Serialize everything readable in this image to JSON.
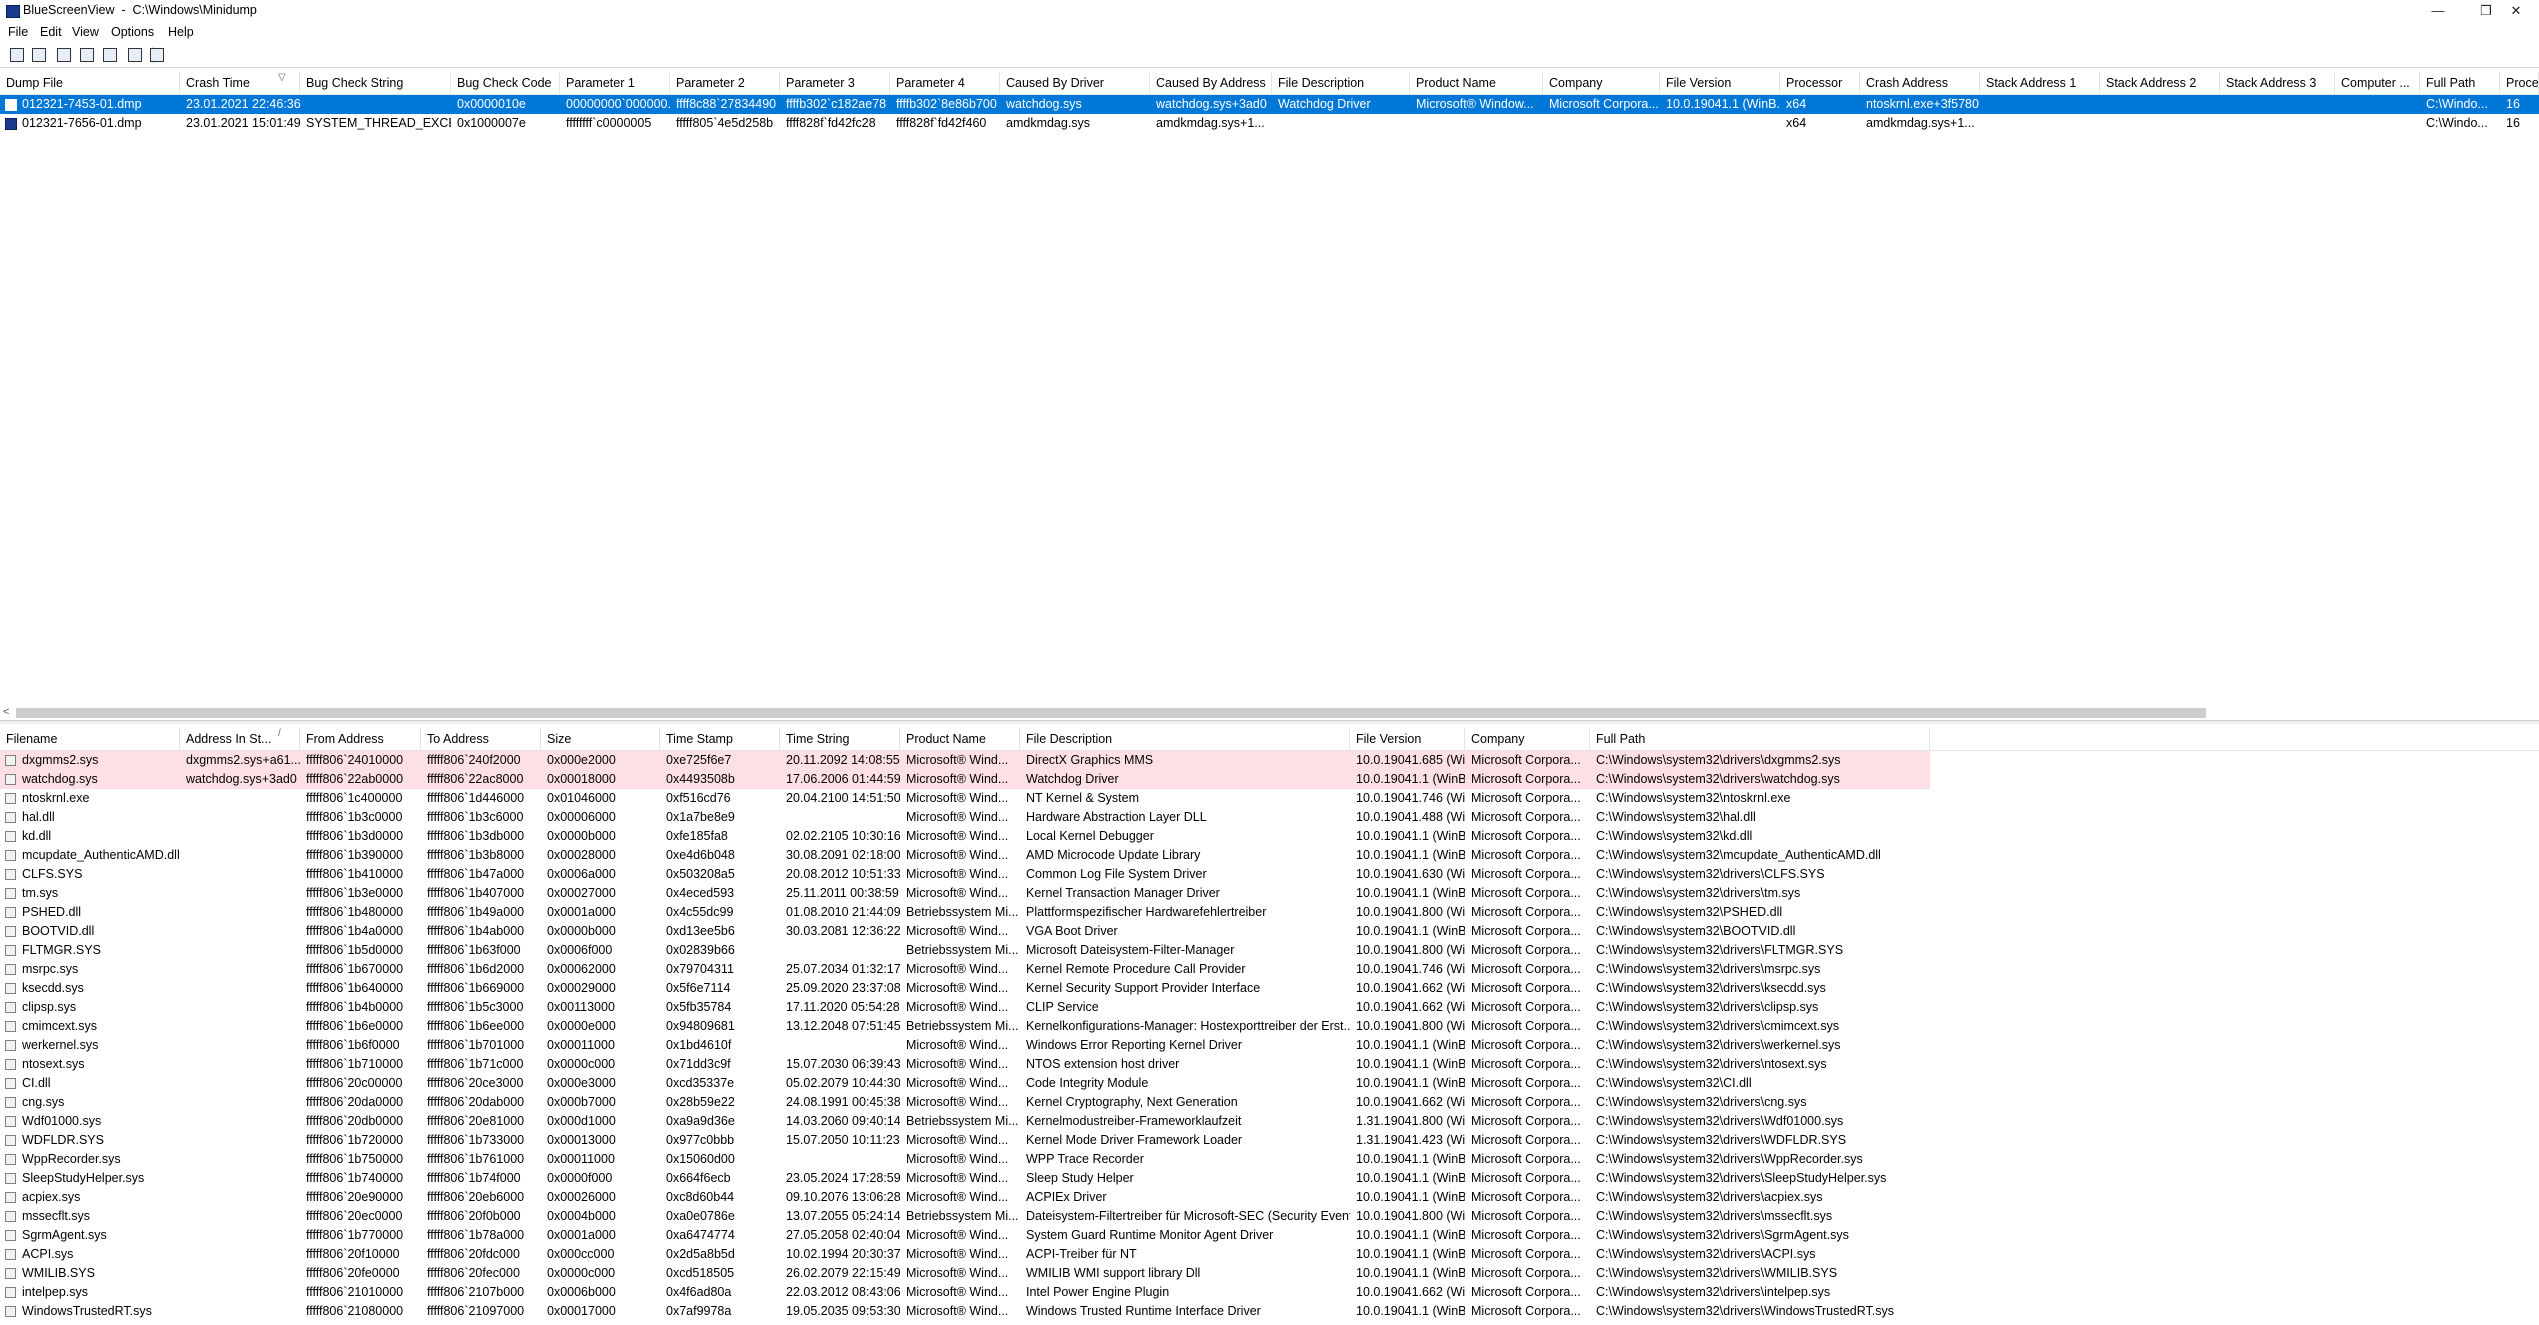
{
  "window": {
    "title": "BlueScreenView  -  C:\\Windows\\Minidump",
    "minimize_glyph": "—",
    "restore_glyph": "❐",
    "close_glyph": "✕"
  },
  "menu": [
    "File",
    "Edit",
    "View",
    "Options",
    "Help"
  ],
  "toolbar": {
    "icons": [
      "save-icon",
      "save-all-icon",
      "refresh-icon",
      "copy-icon",
      "properties-icon",
      "html-report-icon",
      "exit-icon"
    ]
  },
  "top_table": {
    "columns": [
      "Dump File",
      "Crash Time",
      "Bug Check String",
      "Bug Check Code",
      "Parameter 1",
      "Parameter 2",
      "Parameter 3",
      "Parameter 4",
      "Caused By Driver",
      "Caused By Address",
      "File Description",
      "Product Name",
      "Company",
      "File Version",
      "Processor",
      "Crash Address",
      "Stack Address 1",
      "Stack Address 2",
      "Stack Address 3",
      "Computer ...",
      "Full Path",
      "Proces"
    ],
    "sort_indicator": "▽",
    "rows": [
      {
        "selected": true,
        "cells": [
          "012321-7453-01.dmp",
          "23.01.2021 22:46:36",
          "",
          "0x0000010e",
          "00000000`000000...",
          "ffff8c88`27834490",
          "ffffb302`c182ae78",
          "ffffb302`8e86b700",
          "watchdog.sys",
          "watchdog.sys+3ad0",
          "Watchdog Driver",
          "Microsoft® Window...",
          "Microsoft Corpora...",
          "10.0.19041.1 (WinB...",
          "x64",
          "ntoskrnl.exe+3f5780",
          "",
          "",
          "",
          "",
          "C:\\Windo...",
          "16"
        ]
      },
      {
        "selected": false,
        "cells": [
          "012321-7656-01.dmp",
          "23.01.2021 15:01:49",
          "SYSTEM_THREAD_EXCE...",
          "0x1000007e",
          "ffffffff`c0000005",
          "fffff805`4e5d258b",
          "ffff828f`fd42fc28",
          "ffff828f`fd42f460",
          "amdkmdag.sys",
          "amdkmdag.sys+1...",
          "",
          "",
          "",
          "",
          "x64",
          "amdkmdag.sys+1...",
          "",
          "",
          "",
          "",
          "C:\\Windo...",
          "16"
        ]
      }
    ]
  },
  "bottom_table": {
    "columns": [
      "Filename",
      "Address In St...",
      "From Address",
      "To Address",
      "Size",
      "Time Stamp",
      "Time String",
      "Product Name",
      "File Description",
      "File Version",
      "Company",
      "Full Path"
    ],
    "sort_indicator": "/",
    "rows": [
      {
        "hl": true,
        "cells": [
          "dxgmms2.sys",
          "dxgmms2.sys+a61...",
          "fffff806`24010000",
          "fffff806`240f2000",
          "0x000e2000",
          "0xe725f6e7",
          "20.11.2092 14:08:55",
          "Microsoft® Wind...",
          "DirectX Graphics MMS",
          "10.0.19041.685 (Wi...",
          "Microsoft Corpora...",
          "C:\\Windows\\system32\\drivers\\dxgmms2.sys"
        ]
      },
      {
        "hl": true,
        "cells": [
          "watchdog.sys",
          "watchdog.sys+3ad0",
          "fffff806`22ab0000",
          "fffff806`22ac8000",
          "0x00018000",
          "0x4493508b",
          "17.06.2006 01:44:59",
          "Microsoft® Wind...",
          "Watchdog Driver",
          "10.0.19041.1 (WinB...",
          "Microsoft Corpora...",
          "C:\\Windows\\system32\\drivers\\watchdog.sys"
        ]
      },
      {
        "hl": false,
        "cells": [
          "ntoskrnl.exe",
          "",
          "fffff806`1c400000",
          "fffff806`1d446000",
          "0x01046000",
          "0xf516cd76",
          "20.04.2100 14:51:50",
          "Microsoft® Wind...",
          "NT Kernel & System",
          "10.0.19041.746 (Wi...",
          "Microsoft Corpora...",
          "C:\\Windows\\system32\\ntoskrnl.exe"
        ]
      },
      {
        "hl": false,
        "cells": [
          "hal.dll",
          "",
          "fffff806`1b3c0000",
          "fffff806`1b3c6000",
          "0x00006000",
          "0x1a7be8e9",
          "",
          "Microsoft® Wind...",
          "Hardware Abstraction Layer DLL",
          "10.0.19041.488 (Wi...",
          "Microsoft Corpora...",
          "C:\\Windows\\system32\\hal.dll"
        ]
      },
      {
        "hl": false,
        "cells": [
          "kd.dll",
          "",
          "fffff806`1b3d0000",
          "fffff806`1b3db000",
          "0x0000b000",
          "0xfe185fa8",
          "02.02.2105 10:30:16",
          "Microsoft® Wind...",
          "Local Kernel Debugger",
          "10.0.19041.1 (WinB...",
          "Microsoft Corpora...",
          "C:\\Windows\\system32\\kd.dll"
        ]
      },
      {
        "hl": false,
        "cells": [
          "mcupdate_AuthenticAMD.dll",
          "",
          "fffff806`1b390000",
          "fffff806`1b3b8000",
          "0x00028000",
          "0xe4d6b048",
          "30.08.2091 02:18:00",
          "Microsoft® Wind...",
          "AMD Microcode Update Library",
          "10.0.19041.1 (WinB...",
          "Microsoft Corpora...",
          "C:\\Windows\\system32\\mcupdate_AuthenticAMD.dll"
        ]
      },
      {
        "hl": false,
        "cells": [
          "CLFS.SYS",
          "",
          "fffff806`1b410000",
          "fffff806`1b47a000",
          "0x0006a000",
          "0x503208a5",
          "20.08.2012 10:51:33",
          "Microsoft® Wind...",
          "Common Log File System Driver",
          "10.0.19041.630 (Wi...",
          "Microsoft Corpora...",
          "C:\\Windows\\system32\\drivers\\CLFS.SYS"
        ]
      },
      {
        "hl": false,
        "cells": [
          "tm.sys",
          "",
          "fffff806`1b3e0000",
          "fffff806`1b407000",
          "0x00027000",
          "0x4eced593",
          "25.11.2011 00:38:59",
          "Microsoft® Wind...",
          "Kernel Transaction Manager Driver",
          "10.0.19041.1 (WinB...",
          "Microsoft Corpora...",
          "C:\\Windows\\system32\\drivers\\tm.sys"
        ]
      },
      {
        "hl": false,
        "cells": [
          "PSHED.dll",
          "",
          "fffff806`1b480000",
          "fffff806`1b49a000",
          "0x0001a000",
          "0x4c55dc99",
          "01.08.2010 21:44:09",
          "Betriebssystem Mi...",
          "Plattformspezifischer Hardwarefehlertreiber",
          "10.0.19041.800 (Wi...",
          "Microsoft Corpora...",
          "C:\\Windows\\system32\\PSHED.dll"
        ]
      },
      {
        "hl": false,
        "cells": [
          "BOOTVID.dll",
          "",
          "fffff806`1b4a0000",
          "fffff806`1b4ab000",
          "0x0000b000",
          "0xd13ee5b6",
          "30.03.2081 12:36:22",
          "Microsoft® Wind...",
          "VGA Boot Driver",
          "10.0.19041.1 (WinB...",
          "Microsoft Corpora...",
          "C:\\Windows\\system32\\BOOTVID.dll"
        ]
      },
      {
        "hl": false,
        "cells": [
          "FLTMGR.SYS",
          "",
          "fffff806`1b5d0000",
          "fffff806`1b63f000",
          "0x0006f000",
          "0x02839b66",
          "",
          "Betriebssystem Mi...",
          "Microsoft Dateisystem-Filter-Manager",
          "10.0.19041.800 (Wi...",
          "Microsoft Corpora...",
          "C:\\Windows\\system32\\drivers\\FLTMGR.SYS"
        ]
      },
      {
        "hl": false,
        "cells": [
          "msrpc.sys",
          "",
          "fffff806`1b670000",
          "fffff806`1b6d2000",
          "0x00062000",
          "0x79704311",
          "25.07.2034 01:32:17",
          "Microsoft® Wind...",
          "Kernel Remote Procedure Call Provider",
          "10.0.19041.746 (Wi...",
          "Microsoft Corpora...",
          "C:\\Windows\\system32\\drivers\\msrpc.sys"
        ]
      },
      {
        "hl": false,
        "cells": [
          "ksecdd.sys",
          "",
          "fffff806`1b640000",
          "fffff806`1b669000",
          "0x00029000",
          "0x5f6e7114",
          "25.09.2020 23:37:08",
          "Microsoft® Wind...",
          "Kernel Security Support Provider Interface",
          "10.0.19041.662 (Wi...",
          "Microsoft Corpora...",
          "C:\\Windows\\system32\\drivers\\ksecdd.sys"
        ]
      },
      {
        "hl": false,
        "cells": [
          "clipsp.sys",
          "",
          "fffff806`1b4b0000",
          "fffff806`1b5c3000",
          "0x00113000",
          "0x5fb35784",
          "17.11.2020 05:54:28",
          "Microsoft® Wind...",
          "CLIP Service",
          "10.0.19041.662 (Wi...",
          "Microsoft Corpora...",
          "C:\\Windows\\system32\\drivers\\clipsp.sys"
        ]
      },
      {
        "hl": false,
        "cells": [
          "cmimcext.sys",
          "",
          "fffff806`1b6e0000",
          "fffff806`1b6ee000",
          "0x0000e000",
          "0x94809681",
          "13.12.2048 07:51:45",
          "Betriebssystem Mi...",
          "Kernelkonfigurations-Manager: Hostexporttreiber der Erst...",
          "10.0.19041.800 (Wi...",
          "Microsoft Corpora...",
          "C:\\Windows\\system32\\drivers\\cmimcext.sys"
        ]
      },
      {
        "hl": false,
        "cells": [
          "werkernel.sys",
          "",
          "fffff806`1b6f0000",
          "fffff806`1b701000",
          "0x00011000",
          "0x1bd4610f",
          "",
          "Microsoft® Wind...",
          "Windows Error Reporting Kernel Driver",
          "10.0.19041.1 (WinB...",
          "Microsoft Corpora...",
          "C:\\Windows\\system32\\drivers\\werkernel.sys"
        ]
      },
      {
        "hl": false,
        "cells": [
          "ntosext.sys",
          "",
          "fffff806`1b710000",
          "fffff806`1b71c000",
          "0x0000c000",
          "0x71dd3c9f",
          "15.07.2030 06:39:43",
          "Microsoft® Wind...",
          "NTOS extension host driver",
          "10.0.19041.1 (WinB...",
          "Microsoft Corpora...",
          "C:\\Windows\\system32\\drivers\\ntosext.sys"
        ]
      },
      {
        "hl": false,
        "cells": [
          "CI.dll",
          "",
          "fffff806`20c00000",
          "fffff806`20ce3000",
          "0x000e3000",
          "0xcd35337e",
          "05.02.2079 10:44:30",
          "Microsoft® Wind...",
          "Code Integrity Module",
          "10.0.19041.1 (WinB...",
          "Microsoft Corpora...",
          "C:\\Windows\\system32\\CI.dll"
        ]
      },
      {
        "hl": false,
        "cells": [
          "cng.sys",
          "",
          "fffff806`20da0000",
          "fffff806`20dab000",
          "0x000b7000",
          "0x28b59e22",
          "24.08.1991 00:45:38",
          "Microsoft® Wind...",
          "Kernel Cryptography, Next Generation",
          "10.0.19041.662 (Wi...",
          "Microsoft Corpora...",
          "C:\\Windows\\system32\\drivers\\cng.sys"
        ]
      },
      {
        "hl": false,
        "cells": [
          "Wdf01000.sys",
          "",
          "fffff806`20db0000",
          "fffff806`20e81000",
          "0x000d1000",
          "0xa9a9d36e",
          "14.03.2060 09:40:14",
          "Betriebssystem Mi...",
          "Kernelmodustreiber-Frameworklaufzeit",
          "1.31.19041.800 (Wi...",
          "Microsoft Corpora...",
          "C:\\Windows\\system32\\drivers\\Wdf01000.sys"
        ]
      },
      {
        "hl": false,
        "cells": [
          "WDFLDR.SYS",
          "",
          "fffff806`1b720000",
          "fffff806`1b733000",
          "0x00013000",
          "0x977c0bbb",
          "15.07.2050 10:11:23",
          "Microsoft® Wind...",
          "Kernel Mode Driver Framework Loader",
          "1.31.19041.423 (Wi...",
          "Microsoft Corpora...",
          "C:\\Windows\\system32\\drivers\\WDFLDR.SYS"
        ]
      },
      {
        "hl": false,
        "cells": [
          "WppRecorder.sys",
          "",
          "fffff806`1b750000",
          "fffff806`1b761000",
          "0x00011000",
          "0x15060d00",
          "",
          "Microsoft® Wind...",
          "WPP Trace Recorder",
          "10.0.19041.1 (WinB...",
          "Microsoft Corpora...",
          "C:\\Windows\\system32\\drivers\\WppRecorder.sys"
        ]
      },
      {
        "hl": false,
        "cells": [
          "SleepStudyHelper.sys",
          "",
          "fffff806`1b740000",
          "fffff806`1b74f000",
          "0x0000f000",
          "0x664f6ecb",
          "23.05.2024 17:28:59",
          "Microsoft® Wind...",
          "Sleep Study Helper",
          "10.0.19041.1 (WinB...",
          "Microsoft Corpora...",
          "C:\\Windows\\system32\\drivers\\SleepStudyHelper.sys"
        ]
      },
      {
        "hl": false,
        "cells": [
          "acpiex.sys",
          "",
          "fffff806`20e90000",
          "fffff806`20eb6000",
          "0x00026000",
          "0xc8d60b44",
          "09.10.2076 13:06:28",
          "Microsoft® Wind...",
          "ACPIEx Driver",
          "10.0.19041.1 (WinB...",
          "Microsoft Corpora...",
          "C:\\Windows\\system32\\drivers\\acpiex.sys"
        ]
      },
      {
        "hl": false,
        "cells": [
          "mssecflt.sys",
          "",
          "fffff806`20ec0000",
          "fffff806`20f0b000",
          "0x0004b000",
          "0xa0e0786e",
          "13.07.2055 05:24:14",
          "Betriebssystem Mi...",
          "Dateisystem-Filtertreiber für Microsoft-SEC (Security Event...",
          "10.0.19041.800 (Wi...",
          "Microsoft Corpora...",
          "C:\\Windows\\system32\\drivers\\mssecflt.sys"
        ]
      },
      {
        "hl": false,
        "cells": [
          "SgrmAgent.sys",
          "",
          "fffff806`1b770000",
          "fffff806`1b78a000",
          "0x0001a000",
          "0xa6474774",
          "27.05.2058 02:40:04",
          "Microsoft® Wind...",
          "System Guard Runtime Monitor Agent Driver",
          "10.0.19041.1 (WinB...",
          "Microsoft Corpora...",
          "C:\\Windows\\system32\\drivers\\SgrmAgent.sys"
        ]
      },
      {
        "hl": false,
        "cells": [
          "ACPI.sys",
          "",
          "fffff806`20f10000",
          "fffff806`20fdc000",
          "0x000cc000",
          "0x2d5a8b5d",
          "10.02.1994 20:30:37",
          "Microsoft® Wind...",
          "ACPI-Treiber für NT",
          "10.0.19041.1 (WinB...",
          "Microsoft Corpora...",
          "C:\\Windows\\system32\\drivers\\ACPI.sys"
        ]
      },
      {
        "hl": false,
        "cells": [
          "WMILIB.SYS",
          "",
          "fffff806`20fe0000",
          "fffff806`20fec000",
          "0x0000c000",
          "0xcd518505",
          "26.02.2079 22:15:49",
          "Microsoft® Wind...",
          "WMILIB WMI support library Dll",
          "10.0.19041.1 (WinB...",
          "Microsoft Corpora...",
          "C:\\Windows\\system32\\drivers\\WMILIB.SYS"
        ]
      },
      {
        "hl": false,
        "cells": [
          "intelpep.sys",
          "",
          "fffff806`21010000",
          "fffff806`2107b000",
          "0x0006b000",
          "0x4f6ad80a",
          "22.03.2012 08:43:06",
          "Microsoft® Wind...",
          "Intel Power Engine Plugin",
          "10.0.19041.662 (Wi...",
          "Microsoft Corpora...",
          "C:\\Windows\\system32\\drivers\\intelpep.sys"
        ]
      },
      {
        "hl": false,
        "cells": [
          "WindowsTrustedRT.sys",
          "",
          "fffff806`21080000",
          "fffff806`21097000",
          "0x00017000",
          "0x7af9978a",
          "19.05.2035 09:53:30",
          "Microsoft® Wind...",
          "Windows Trusted Runtime Interface Driver",
          "10.0.19041.1 (WinB...",
          "Microsoft Corpora...",
          "C:\\Windows\\system32\\drivers\\WindowsTrustedRT.sys"
        ]
      }
    ]
  },
  "scrollbar": {
    "left_arrow": "<"
  }
}
